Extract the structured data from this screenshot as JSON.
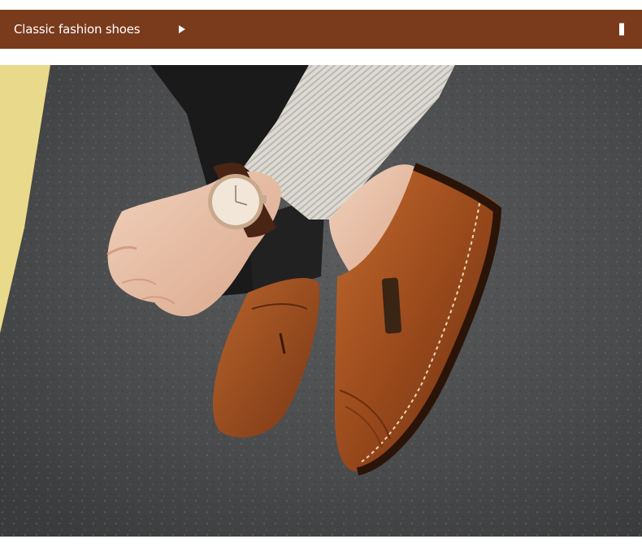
{
  "banner": {
    "title": "Classic fashion shoes",
    "background": "#7a3a1c",
    "arrow_icon": "play-arrow-icon",
    "bar_icon": "vertical-bar-icon"
  },
  "photo": {
    "subject": "product-photo",
    "colors": {
      "asphalt": "#4a4b4c",
      "curb": "#e9d98a",
      "shoe": "#a3501f",
      "sock": "#d8d6ce",
      "trousers": "#1b1a1a",
      "skin": "#e8bfa6",
      "watch_face": "#f2e6d8"
    }
  }
}
